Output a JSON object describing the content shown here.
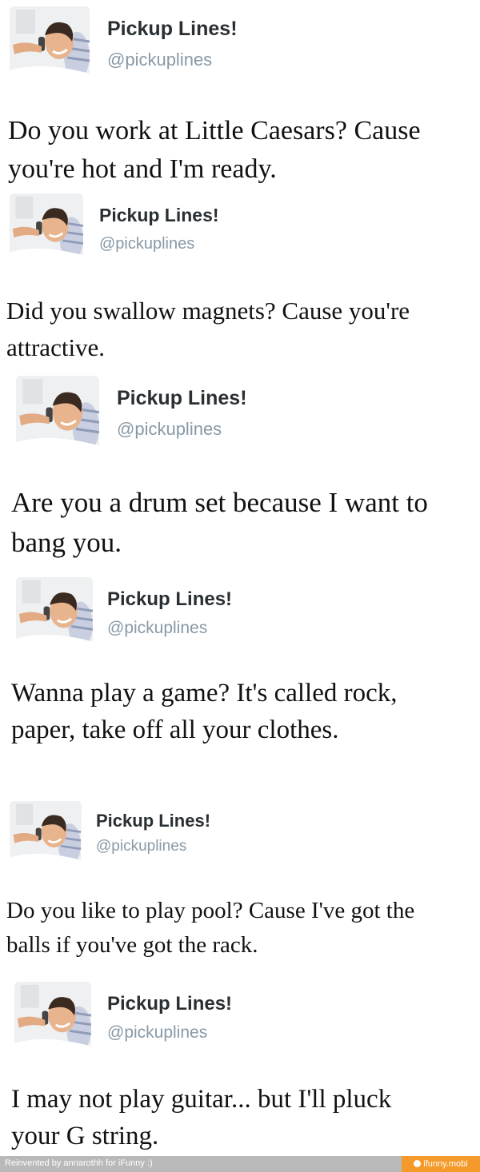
{
  "tweets": [
    {
      "name": "Pickup Lines!",
      "handle": "@pickuplines",
      "text": "Do you work at Little Caesars? Cause you're hot and I'm ready."
    },
    {
      "name": "Pickup Lines!",
      "handle": "@pickuplines",
      "text": "Did you swallow magnets? Cause you're attractive."
    },
    {
      "name": "Pickup Lines!",
      "handle": "@pickuplines",
      "text": "Are you a drum set because I want to bang you."
    },
    {
      "name": "Pickup Lines!",
      "handle": "@pickuplines",
      "text": "Wanna play a game? It's called rock, paper, take off all your clothes."
    },
    {
      "name": "Pickup Lines!",
      "handle": "@pickuplines",
      "text": "Do you like to play pool? Cause I've got the balls if you've got the rack."
    },
    {
      "name": "Pickup Lines!",
      "handle": "@pickuplines",
      "text": "I may not play guitar... but I'll pluck your G string."
    }
  ],
  "footer": {
    "credit": "Reinvented by annarothh for iFunny :)",
    "site": "ifunny.mobi"
  },
  "colors": {
    "name": "#292f33",
    "handle": "#8899a6",
    "footer_bar": "#b9b9b9",
    "footer_badge": "#f39a2a"
  },
  "icons": {
    "avatar": "man-on-phone-avatar",
    "footer_badge": "ifunny-logo-icon"
  }
}
